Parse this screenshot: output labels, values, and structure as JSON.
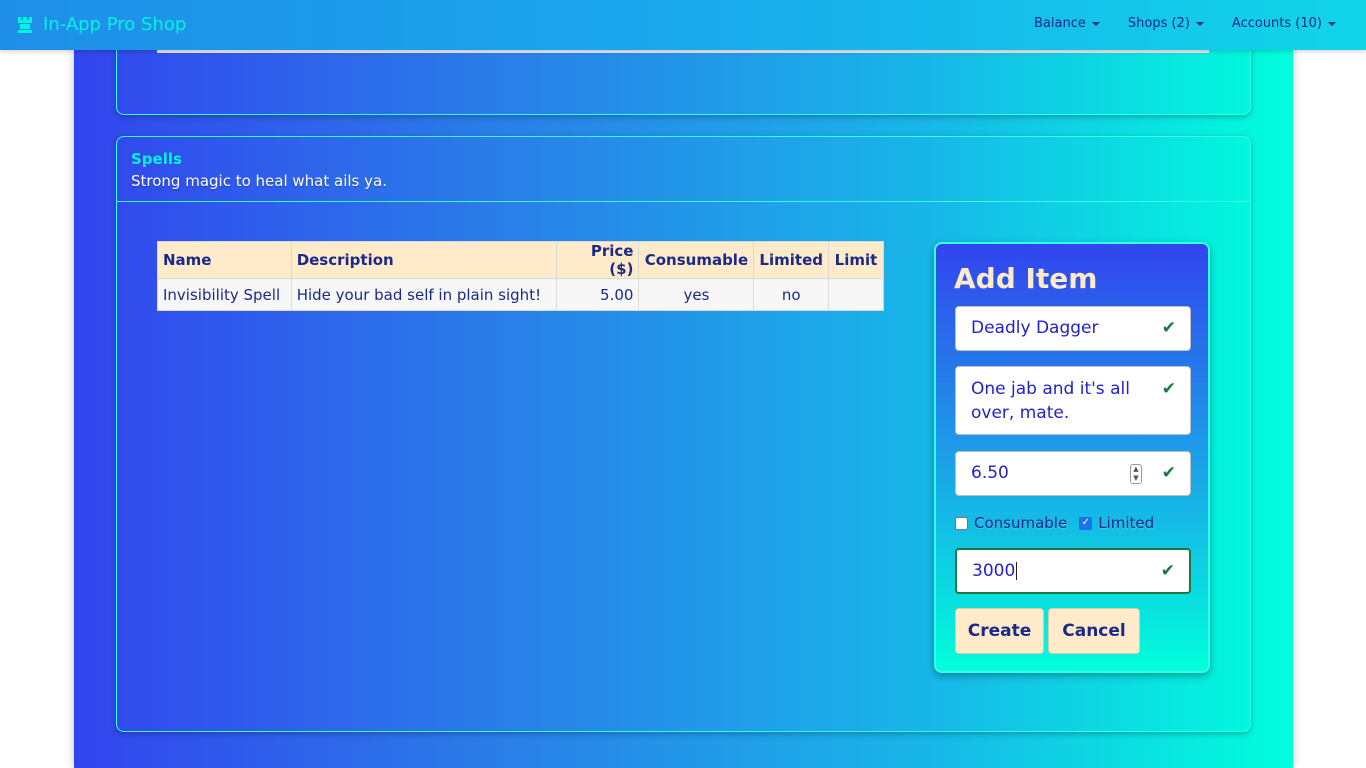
{
  "navbar": {
    "brand": "In-App Pro Shop",
    "logo_icon": "rook-icon",
    "menu": [
      {
        "label": "Balance"
      },
      {
        "label": "Shops (2)"
      },
      {
        "label": "Accounts (10)"
      }
    ]
  },
  "category": {
    "title": "Spells",
    "subtitle": "Strong magic to heal what ails ya."
  },
  "table": {
    "headers": {
      "name": "Name",
      "description": "Description",
      "price": "Price ($)",
      "consumable": "Consumable",
      "limited": "Limited",
      "limit": "Limit"
    },
    "rows": [
      {
        "name": "Invisibility Spell",
        "description": "Hide your bad self in plain sight!",
        "price": "5.00",
        "consumable": "yes",
        "limited": "no",
        "limit": ""
      }
    ]
  },
  "add_item": {
    "title": "Add Item",
    "name_value": "Deadly Dagger",
    "description_value": "One jab and it's all over, mate.",
    "price_value": "6.50",
    "consumable_label": "Consumable",
    "consumable_checked": false,
    "limited_label": "Limited",
    "limited_checked": true,
    "limit_value": "3000",
    "create_label": "Create",
    "cancel_label": "Cancel",
    "valid_icon": "check-icon"
  },
  "colors": {
    "accent": "#00f5e0",
    "text_dark": "#1a2a8a",
    "header_bg": "#ffebc9",
    "valid": "#1a7a3c"
  }
}
